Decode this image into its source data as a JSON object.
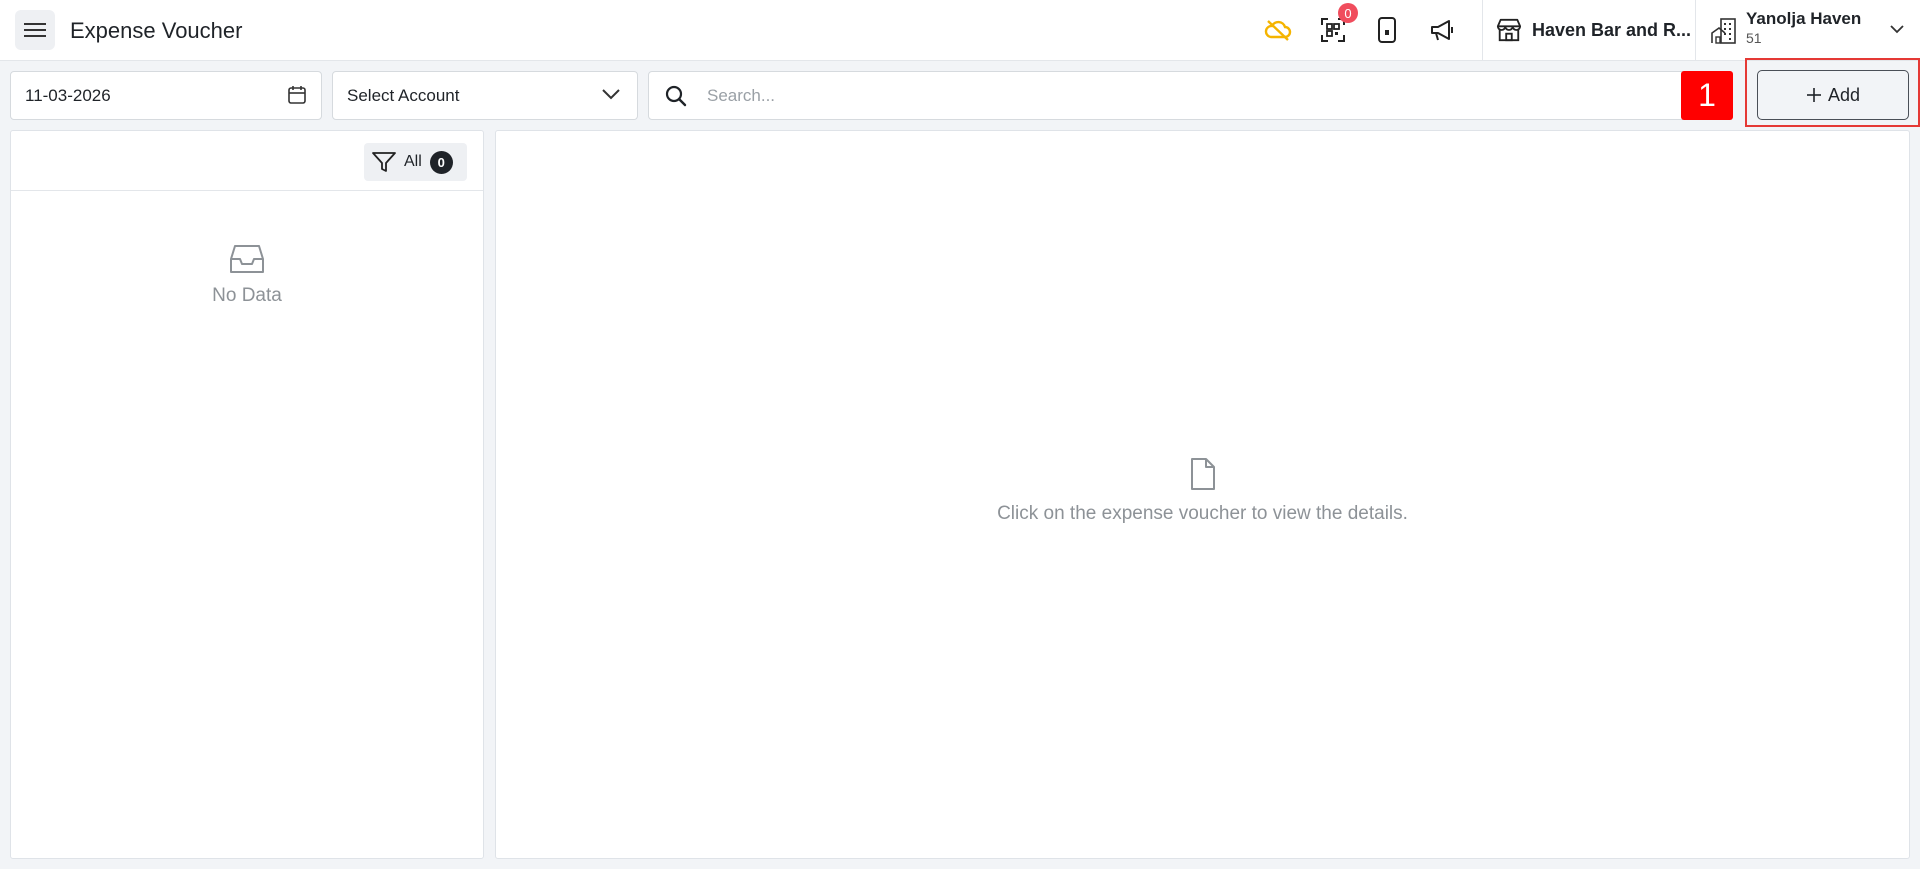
{
  "header": {
    "title": "Expense Voucher",
    "notification_count": "0",
    "outlet_name": "Haven Bar and R...",
    "hotel_name": "Yanolja Haven",
    "hotel_code": "51",
    "icons": [
      "menu-icon",
      "cloud-off-icon",
      "qr-scan-icon",
      "mobile-icon",
      "megaphone-icon",
      "store-icon",
      "hotel-building-icon",
      "chevron-down-icon"
    ]
  },
  "toolbar": {
    "date_value": "11-03-2026",
    "account_select": "Select Account",
    "search_placeholder": "Search...",
    "step_marker": "1",
    "add_label": "Add"
  },
  "list_panel": {
    "filter_label": "All",
    "filter_count": "0",
    "empty_text": "No Data"
  },
  "detail_panel": {
    "empty_text": "Click on the expense voucher to view the details."
  },
  "colors": {
    "warning_icon": "#f5b400",
    "badge": "#f04d5d",
    "step_marker": "#ff0000",
    "highlight": "#e53935"
  }
}
